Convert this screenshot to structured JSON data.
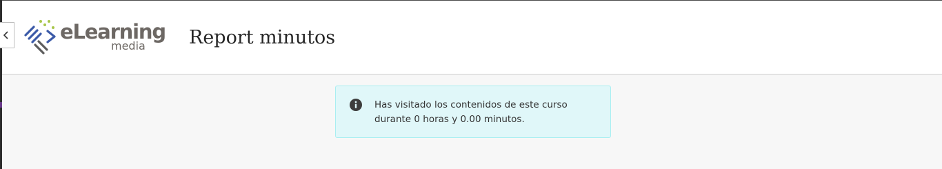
{
  "header": {
    "close_glyph": "‹",
    "logo": {
      "main": "eLearning",
      "sub": "media",
      "text_color": "#6d6864",
      "mark_colors": [
        "#3b5aa8",
        "#a8c64a",
        "#5d5d5d"
      ]
    },
    "page_title": "Report minutos"
  },
  "alert": {
    "icon": "info-circle-icon",
    "message": "Has visitado los contenidos de este curso durante 0 horas y 0.00 minutos.",
    "background": "#e0f7f9",
    "border": "#a9eef1"
  }
}
